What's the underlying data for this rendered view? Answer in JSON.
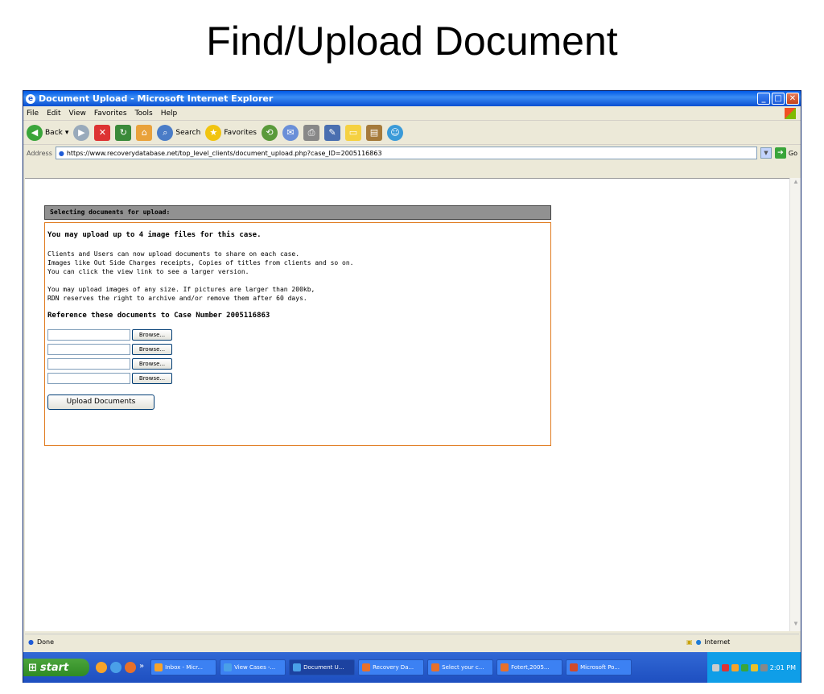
{
  "slide": {
    "title": "Find/Upload Document"
  },
  "window": {
    "title": "Document Upload - Microsoft Internet Explorer",
    "menu": [
      "File",
      "Edit",
      "View",
      "Favorites",
      "Tools",
      "Help"
    ],
    "toolbar": {
      "back": "Back",
      "search": "Search",
      "favorites": "Favorites"
    },
    "address": {
      "label": "Address",
      "url": "https://www.recoverydatabase.net/top_level_clients/document_upload.php?case_ID=2005116863",
      "go": "Go"
    }
  },
  "page": {
    "panel_heading": "Selecting documents for upload:",
    "limit_text": "You may upload up to 4 image files for this case.",
    "intro_lines": [
      "Clients and Users can now upload documents to share on each case.",
      "Images like Out Side Charges receipts, Copies of titles from clients and so on.",
      "You can click the view link to see a larger version."
    ],
    "size_lines": [
      "You may upload images of any size. If pictures are larger than 200kb,",
      "RDN reserves the right to archive and/or remove them after 60 days."
    ],
    "reference_text": "Reference these documents to Case Number 2005116863",
    "browse_label": "Browse...",
    "upload_label": "Upload Documents"
  },
  "statusbar": {
    "status": "Done",
    "zone": "Internet"
  },
  "taskbar": {
    "start": "start",
    "tasks": [
      "Inbox - Micr...",
      "View Cases -...",
      "Document U...",
      "Recovery Da...",
      "Select your c...",
      "Fotert,2005...",
      "Microsoft Po..."
    ],
    "clock": "2:01 PM"
  },
  "colors": {
    "accent_border": "#e07a1e",
    "header_bg": "#919191",
    "taskbar": "#245edb"
  }
}
